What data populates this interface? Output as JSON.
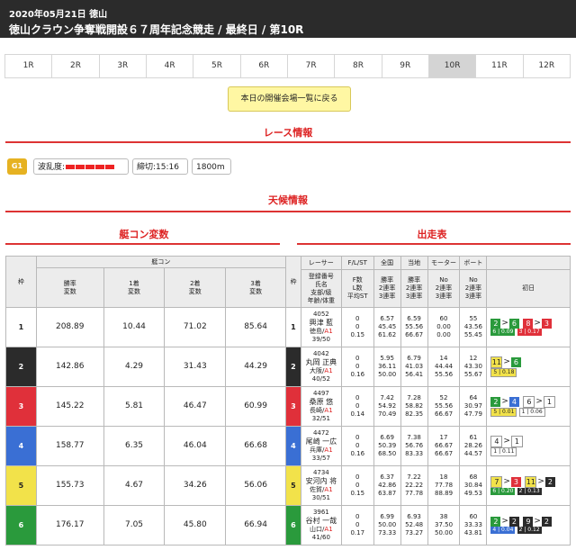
{
  "header": {
    "date": "2020年05月21日 徳山",
    "title": "徳山クラウン争奪戦開設６７周年記念競走 / 最終日 / 第10R"
  },
  "races": [
    "1R",
    "2R",
    "3R",
    "4R",
    "5R",
    "6R",
    "7R",
    "8R",
    "9R",
    "10R",
    "11R",
    "12R"
  ],
  "active_race": "10R",
  "venue_button": "本日の開催会場一覧に戻る",
  "sections": {
    "race_info": "レース情報",
    "weather": "天候情報",
    "boat_con": "艇コン変数",
    "entry": "出走表"
  },
  "race_info": {
    "grade": "G1",
    "wave_label": "波乱度:",
    "deadline": "締切:15:16",
    "distance": "1800m"
  },
  "boat_table": {
    "group": "艇コン",
    "lane_header": "枠",
    "headers": [
      "勝率\n変数",
      "1着\n変数",
      "2着\n変数",
      "3着\n変数"
    ],
    "rows": [
      [
        "208.89",
        "10.44",
        "71.02",
        "85.64"
      ],
      [
        "142.86",
        "4.29",
        "31.43",
        "44.29"
      ],
      [
        "145.22",
        "5.81",
        "46.47",
        "60.99"
      ],
      [
        "158.77",
        "6.35",
        "46.04",
        "66.68"
      ],
      [
        "155.73",
        "4.67",
        "34.26",
        "56.06"
      ],
      [
        "176.17",
        "7.05",
        "45.80",
        "66.94"
      ]
    ]
  },
  "entry_table": {
    "headers": [
      "枠",
      "レーサー",
      "F/L/ST",
      "全国",
      "当地",
      "モーター",
      "ボート",
      ""
    ],
    "subheaders": [
      "登録番号\n氏名\n支部/級\n年齢/体重",
      "F数\nL数\n平均ST",
      "勝率\n2連率\n3連率",
      "勝率\n2連率\n3連率",
      "No\n2連率\n3連率",
      "No\n2連率\n3連率",
      "初日"
    ],
    "rows": [
      {
        "reg": "4052",
        "name": "興津 藍",
        "branch": "徳島/A1",
        "age": "39/50",
        "fl": "0\n0\n0.15",
        "nat": "6.57\n45.45\n61.62",
        "loc": "6.59\n55.56\n66.67",
        "motor": "60\n0.00\n0.00",
        "boat": "55\n43.56\n55.45",
        "day1": [
          {
            "c": "2",
            "to": "6",
            "tc": "s6"
          },
          {
            "c": "8",
            "to": "3",
            "tc": "s3"
          }
        ],
        "st": [
          "6 | 0.09",
          "3 | 0.17"
        ],
        "stc": [
          "s6",
          "s3"
        ]
      },
      {
        "reg": "4042",
        "name": "丸岡 正典",
        "branch": "大阪/A1",
        "age": "40/52",
        "fl": "0\n0\n0.16",
        "nat": "5.95\n36.11\n50.00",
        "loc": "6.79\n41.03\n56.41",
        "motor": "14\n44.44\n55.56",
        "boat": "12\n43.30\n55.67",
        "day1": [
          {
            "c": "11",
            "to": "6",
            "tc": "s6"
          }
        ],
        "st": [
          "5 | 0.18"
        ],
        "stc": [
          "s5"
        ]
      },
      {
        "reg": "4497",
        "name": "桑原 悠",
        "branch": "長崎/A1",
        "age": "32/51",
        "fl": "0\n0\n0.14",
        "nat": "7.42\n54.92\n70.49",
        "loc": "7.28\n58.82\n82.35",
        "motor": "52\n55.56\n66.67",
        "boat": "64\n30.97\n47.79",
        "day1": [
          {
            "c": "2",
            "to": "4",
            "tc": "s4"
          },
          {
            "c": "6",
            "to": "1",
            "tc": "s1"
          }
        ],
        "st": [
          "5 | 0.01",
          "1 | 0.06"
        ],
        "stc": [
          "s5",
          "s1"
        ]
      },
      {
        "reg": "4472",
        "name": "尾崎 一広",
        "branch": "兵庫/A1",
        "age": "33/57",
        "fl": "0\n0\n0.16",
        "nat": "6.69\n50.39\n68.50",
        "loc": "7.38\n56.76\n83.33",
        "motor": "17\n66.67\n66.67",
        "boat": "61\n28.26\n44.57",
        "day1": [
          {
            "c": "4",
            "to": "1",
            "tc": "s1"
          }
        ],
        "st": [
          "1 | 0.11"
        ],
        "stc": [
          "s1"
        ]
      },
      {
        "reg": "4734",
        "name": "安河内 将",
        "branch": "佐賀/A1",
        "age": "30/51",
        "fl": "0\n0\n0.15",
        "nat": "6.37\n42.86\n63.87",
        "loc": "7.22\n22.22\n77.78",
        "motor": "18\n77.78\n88.89",
        "boat": "68\n30.84\n49.53",
        "day1": [
          {
            "c": "7",
            "to": "3",
            "tc": "s3"
          },
          {
            "c": "11",
            "to": "2",
            "tc": "s2"
          }
        ],
        "st": [
          "6 | 0.20",
          "2 | 0.13"
        ],
        "stc": [
          "s6",
          "s2"
        ]
      },
      {
        "reg": "3961",
        "name": "谷村 一哉",
        "branch": "山口/A1",
        "age": "41/60",
        "fl": "0\n0\n0.17",
        "nat": "6.99\n50.00\n73.33",
        "loc": "6.93\n52.48\n73.27",
        "motor": "38\n37.50\n50.00",
        "boat": "60\n33.33\n43.81",
        "day1": [
          {
            "c": "2",
            "to": "2",
            "tc": "s2"
          },
          {
            "c": "9",
            "to": "2",
            "tc": "s2"
          }
        ],
        "st": [
          "4 | 0.04",
          "2 | 0.12"
        ],
        "stc": [
          "s4",
          "s2"
        ]
      }
    ]
  },
  "colors": {
    "accent": "#dd2222",
    "grade": "#e6b222",
    "button": "#fff7a3"
  }
}
